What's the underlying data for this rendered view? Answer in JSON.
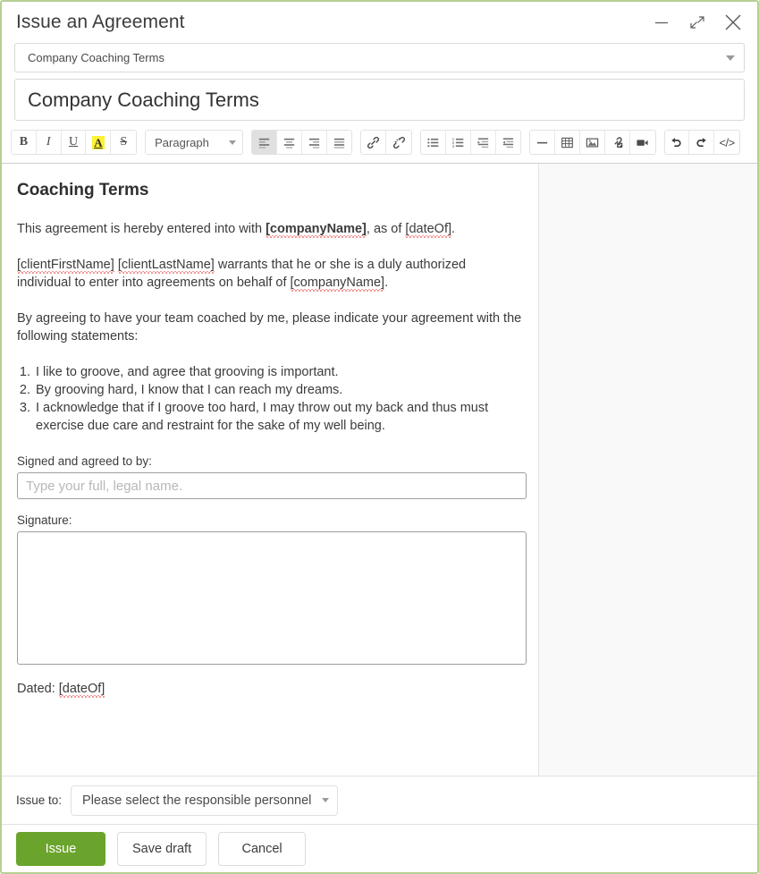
{
  "window": {
    "title": "Issue an Agreement",
    "controls": [
      {
        "name": "minimize-button",
        "glyph": "minimize-icon"
      },
      {
        "name": "restore-button",
        "glyph": "collapse-icon"
      },
      {
        "name": "close-button",
        "glyph": "close-icon"
      }
    ]
  },
  "template_select": {
    "value": "Company Coaching Terms"
  },
  "title_field": {
    "value": "Company Coaching Terms"
  },
  "toolbar": {
    "groups": [
      {
        "name": "text-format-group",
        "buttons": [
          {
            "name": "bold-button",
            "icon": "bold-icon",
            "label": "B"
          },
          {
            "name": "italic-button",
            "icon": "italic-icon",
            "label": "I"
          },
          {
            "name": "underline-button",
            "icon": "underline-icon",
            "label": "U"
          },
          {
            "name": "highlight-color-button",
            "icon": "text-highlight-icon",
            "label": "A"
          },
          {
            "name": "strikethrough-button",
            "icon": "strikethrough-icon",
            "label": "S"
          }
        ]
      }
    ],
    "block_format": {
      "name": "paragraph-style-select",
      "value": "Paragraph"
    },
    "align_buttons": [
      {
        "name": "align-left-button",
        "icon": "align-left-icon",
        "active": true
      },
      {
        "name": "align-center-button",
        "icon": "align-center-icon",
        "active": false
      },
      {
        "name": "align-right-button",
        "icon": "align-right-icon",
        "active": false
      },
      {
        "name": "align-justify-button",
        "icon": "align-justify-icon",
        "active": false
      }
    ],
    "link_buttons": [
      {
        "name": "insert-link-button",
        "icon": "link-icon"
      },
      {
        "name": "remove-link-button",
        "icon": "unlink-icon"
      }
    ],
    "list_buttons": [
      {
        "name": "bulleted-list-button",
        "icon": "bulleted-list-icon"
      },
      {
        "name": "numbered-list-button",
        "icon": "numbered-list-icon"
      },
      {
        "name": "increase-indent-button",
        "icon": "indent-icon"
      },
      {
        "name": "decrease-indent-button",
        "icon": "outdent-icon"
      }
    ],
    "insert_buttons": [
      {
        "name": "horizontal-rule-button",
        "icon": "horizontal-rule-icon"
      },
      {
        "name": "insert-table-button",
        "icon": "table-icon"
      },
      {
        "name": "insert-image-button",
        "icon": "image-icon"
      },
      {
        "name": "insert-merge-field-button",
        "icon": "merge-field-icon"
      },
      {
        "name": "insert-video-button",
        "icon": "video-icon"
      }
    ],
    "history_buttons": [
      {
        "name": "undo-button",
        "icon": "undo-icon"
      },
      {
        "name": "redo-button",
        "icon": "redo-icon"
      },
      {
        "name": "source-code-button",
        "icon": "code-icon",
        "label": "</>"
      }
    ]
  },
  "document": {
    "heading": "Coaching Terms",
    "paragraph_1": {
      "part_1": "This agreement is hereby entered into with ",
      "token_1": "[companyName]",
      "part_2": ", as of ",
      "token_2": "[dateOf]",
      "part_3": "."
    },
    "paragraph_2": {
      "token_1": "[clientFirstName]",
      "part_1": " ",
      "token_2": "[clientLastName]",
      "part_2": " warrants that he or she is a duly authorized individual to enter into agreements on behalf of ",
      "token_3": "[companyName]",
      "part_3": "."
    },
    "paragraph_3": "By agreeing to have your team coached by me, please indicate your agreement with the following statements:",
    "list_items": [
      "I like to groove, and agree that grooving is important.",
      "By grooving hard, I know that I can reach my dreams.",
      "I acknowledge that if I groove too hard, I may throw out my back and thus must exercise due care and restraint for the sake of my well being."
    ],
    "signed_label": "Signed and agreed to by:",
    "signed_placeholder": "Type your full, legal name.",
    "signed_value": "",
    "signature_label": "Signature:",
    "dated_prefix": "Dated: ",
    "dated_token": "[dateOf]"
  },
  "issue_to": {
    "label": "Issue to:",
    "select_value": "Please select the responsible personnel"
  },
  "footer": {
    "issue_label": "Issue",
    "save_draft_label": "Save draft",
    "cancel_label": "Cancel"
  },
  "colors": {
    "dialog_border": "#b5d194",
    "primary_button": "#6ba42d",
    "highlight": "#fdf333",
    "spellcheck_underline": "#ee3333",
    "page_side": "#f9f9f9"
  }
}
